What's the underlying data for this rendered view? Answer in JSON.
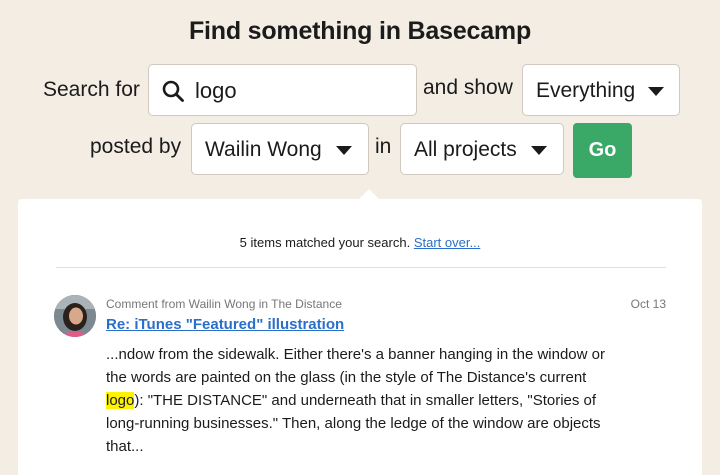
{
  "heading": "Find something in Basecamp",
  "search": {
    "label": "Search for",
    "query": "logo",
    "show_label": "and show",
    "show_value": "Everything"
  },
  "filter": {
    "posted_by_label": "posted by",
    "person": "Wailin Wong",
    "in_label": "in",
    "project": "All projects",
    "go_label": "Go"
  },
  "results": {
    "summary": "5 items matched your search.",
    "start_over": "Start over...",
    "items": [
      {
        "meta": "Comment from Wailin Wong in The Distance",
        "date": "Oct 13",
        "title": "Re: iTunes \"Featured\" illustration",
        "excerpt_before": "...ndow from the sidewalk. Either there's a banner hanging in the window or the words are painted on the glass (in the style of The Distance's current ",
        "excerpt_highlight": "logo",
        "excerpt_after": "): \"THE DISTANCE\" and underneath that in smaller letters, \"Stories of long-running businesses.\" Then, along the ledge of the window are objects that..."
      }
    ]
  },
  "colors": {
    "background": "#f3ede4",
    "go_button": "#3aa866",
    "link": "#2a6fc9",
    "highlight": "#fdf200"
  }
}
